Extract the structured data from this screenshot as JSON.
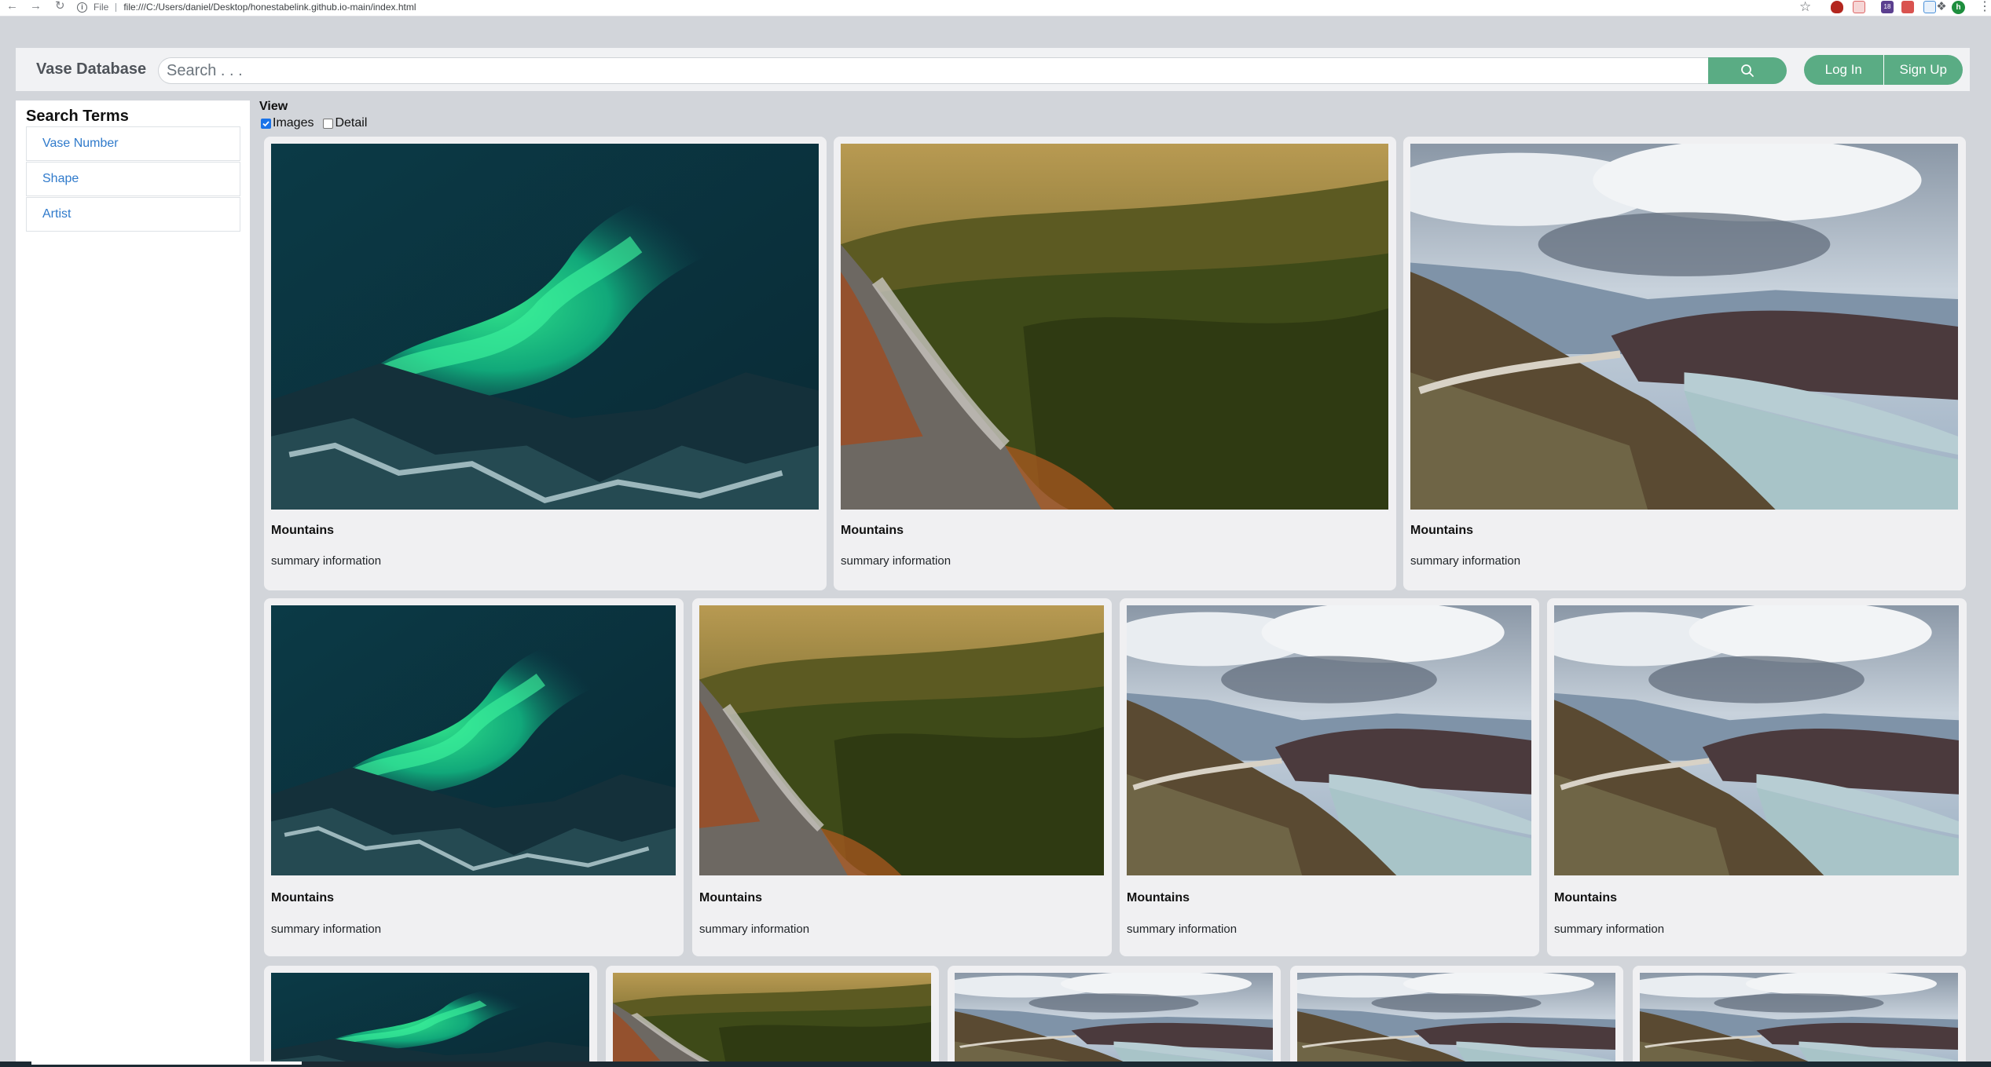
{
  "browser": {
    "scheme_label": "File",
    "url": "file:///C:/Users/daniel/Desktop/honestabelink.github.io-main/index.html",
    "profile_initial": "h",
    "extension_badge": "18"
  },
  "navbar": {
    "brand": "Vase Database",
    "search_placeholder": "Search . . .",
    "search_icon": "search-icon",
    "login_label": "Log In",
    "signup_label": "Sign Up",
    "accent_color": "#5aac84"
  },
  "sidebar": {
    "heading": "Search Terms",
    "items": [
      {
        "label": "Vase Number"
      },
      {
        "label": "Shape"
      },
      {
        "label": "Artist"
      }
    ]
  },
  "view": {
    "label": "View",
    "options": [
      {
        "label": "Images",
        "checked": true
      },
      {
        "label": "Detail",
        "checked": false
      }
    ]
  },
  "rows": [
    {
      "cards": [
        {
          "image": "aurora",
          "title": "Mountains",
          "summary": "summary information"
        },
        {
          "image": "forest-cliff",
          "title": "Mountains",
          "summary": "summary information"
        },
        {
          "image": "lake-valley",
          "title": "Mountains",
          "summary": "summary information"
        }
      ]
    },
    {
      "cards": [
        {
          "image": "aurora",
          "title": "Mountains",
          "summary": "summary information"
        },
        {
          "image": "forest-cliff",
          "title": "Mountains",
          "summary": "summary information"
        },
        {
          "image": "lake-valley",
          "title": "Mountains",
          "summary": "summary information"
        },
        {
          "image": "lake-valley",
          "title": "Mountains",
          "summary": "summary information"
        }
      ]
    },
    {
      "cards": [
        {
          "image": "aurora"
        },
        {
          "image": "forest-cliff"
        },
        {
          "image": "lake-valley"
        },
        {
          "image": "lake-valley"
        },
        {
          "image": "lake-valley"
        }
      ]
    }
  ]
}
